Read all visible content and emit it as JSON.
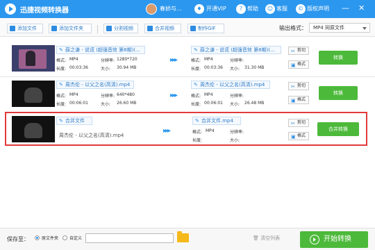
{
  "app": {
    "title": "迅捷视频转换器"
  },
  "titlebar": {
    "user": "春娇与...",
    "vip": "开通VIP",
    "help": "帮助",
    "service": "客服",
    "copyright": "版权声明",
    "minimize": "—",
    "close": "✕"
  },
  "toolbar": {
    "add_file": "添加文件",
    "add_folder": "添加文件夹",
    "split": "分割视频",
    "merge": "合并视频",
    "gif": "制作GIF",
    "output_label": "输出格式：",
    "output_value": "MP4  同原文件"
  },
  "labels": {
    "format": "格式:",
    "duration": "长度:",
    "resolution": "分辨率:",
    "size": "大小:",
    "cut": "剪切",
    "fmt": "格式",
    "convert": "转换",
    "merge_convert": "合并转换"
  },
  "rows": [
    {
      "src": {
        "name": "薛之谦 - 说谎 (超强音效 第8期)(...",
        "format": "MP4",
        "duration": "00:03:36",
        "resolution": "1280*720",
        "size": "30.94 MB"
      },
      "dst": {
        "name": "薛之谦 - 说谎 (超强音效 第8期)(...",
        "format": "MP4",
        "duration": "00:03:36",
        "resolution": "",
        "size": "31.30 MB"
      }
    },
    {
      "src": {
        "name": "周杰伦 - 以父之名(高清).mp4",
        "format": "MP4",
        "duration": "00:06:01",
        "resolution": "640*480",
        "size": "26.60 MB"
      },
      "dst": {
        "name": "周杰伦 - 以父之名(高清).mp4",
        "format": "MP4",
        "duration": "00:06:01",
        "resolution": "",
        "size": "26.48 MB"
      }
    }
  ],
  "merge": {
    "src_name": "合并文件",
    "src_file": "周杰伦 - 以父之名(高清).mp4",
    "dst_name": "合并文件.mp4",
    "format": "MP4"
  },
  "bottom": {
    "save_to": "保存至：",
    "opt_source": "原文件夹",
    "opt_custom": "自定义",
    "clear": "清空列表",
    "start": "开始转换"
  }
}
